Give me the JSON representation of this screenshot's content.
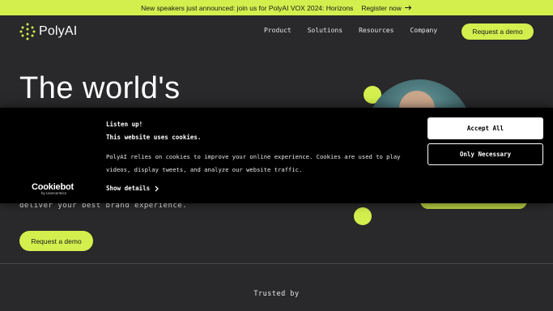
{
  "announcement": {
    "text": "New speakers just announced: join us for PolyAI VOX 2024: Horizons",
    "link_label": "Register now",
    "link_icon": "arrow-right-icon"
  },
  "nav": {
    "logo_text": "PolyAI",
    "links": [
      "Product",
      "Solutions",
      "Resources",
      "Company"
    ],
    "cta": "Request a demo"
  },
  "hero": {
    "title": "The world's",
    "subtitle": "deliver your best brand experience.",
    "cta": "Request a demo"
  },
  "trusted": {
    "label": "Trusted by"
  },
  "cookie_banner": {
    "title": "Listen up!",
    "subtitle": "This website uses cookies.",
    "body": "PolyAI relies on cookies to improve your online experience. Cookies are used to play videos, display tweets, and analyze our website traffic.",
    "details_label": "Show details",
    "accept_label": "Accept All",
    "necessary_label": "Only Necessary",
    "brand": "Cookiebot",
    "brand_by": "by Usercentrics"
  },
  "colors": {
    "accent": "#d3ef4e",
    "background": "#29282a",
    "banner": "#000000"
  }
}
